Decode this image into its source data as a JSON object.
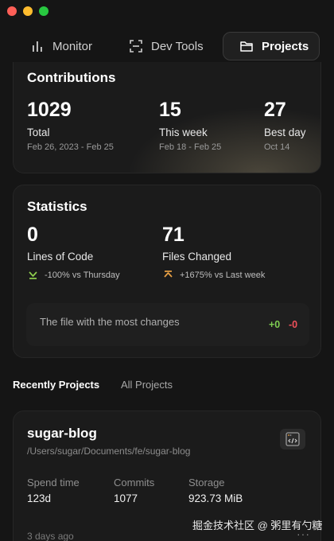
{
  "nav": {
    "tabs": [
      {
        "label": "Monitor",
        "icon": "bar-chart-icon"
      },
      {
        "label": "Dev Tools",
        "icon": "scan-icon"
      },
      {
        "label": "Projects",
        "icon": "folder-icon",
        "active": true
      }
    ]
  },
  "contributions": {
    "title": "Contributions",
    "stats": [
      {
        "value": "1029",
        "label": "Total",
        "range": "Feb 26, 2023 - Feb 25"
      },
      {
        "value": "15",
        "label": "This week",
        "range": "Feb 18 - Feb 25"
      },
      {
        "value": "27",
        "label": "Best day",
        "range": "Oct 14"
      }
    ]
  },
  "statistics": {
    "title": "Statistics",
    "lines": {
      "value": "0",
      "label": "Lines of Code",
      "change": "-100% vs Thursday",
      "direction": "down",
      "color": "#8fcf4f"
    },
    "files": {
      "value": "71",
      "label": "Files Changed",
      "change": "+1675% vs Last week",
      "direction": "up",
      "color": "#e8a045"
    },
    "most_changes": {
      "text": "The file with the most changes",
      "added": "+0",
      "removed": "-0"
    }
  },
  "projects": {
    "tabs": {
      "recent": "Recently Projects",
      "all": "All Projects"
    },
    "item": {
      "name": "sugar-blog",
      "path": "/Users/sugar/Documents/fe/sugar-blog",
      "icon": "code-icon",
      "spend_label": "Spend time",
      "spend_value": "123d",
      "commits_label": "Commits",
      "commits_value": "1077",
      "storage_label": "Storage",
      "storage_value": "923.73 MiB",
      "last_updated": "3 days ago",
      "more": "···"
    }
  },
  "watermark": "掘金技术社区 @ 粥里有勺糖"
}
